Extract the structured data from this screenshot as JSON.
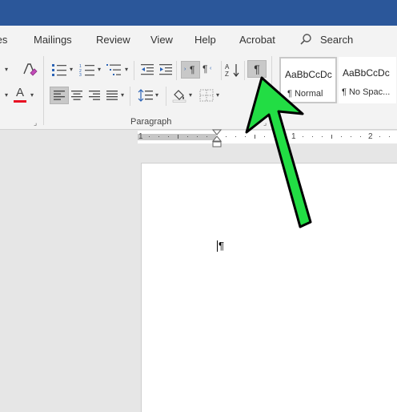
{
  "tabs": [
    "tes",
    "Mailings",
    "Review",
    "View",
    "Help",
    "Acrobat"
  ],
  "search": {
    "label": "Search"
  },
  "ribbon": {
    "group_label": "Paragraph",
    "show_hide_symbol": "¶",
    "ltr_symbol": "¶",
    "rtl_symbol": "¶",
    "font_color_letter": "A",
    "font_color": "#e81123"
  },
  "styles": [
    {
      "preview": "AaBbCcDc",
      "name": "¶ Normal"
    },
    {
      "preview": "AaBbCcDc",
      "name": "¶ No Spac..."
    }
  ],
  "ruler": {
    "numbers": [
      "1",
      "1",
      "2"
    ]
  },
  "document": {
    "paragraph_mark": "¶"
  },
  "annotation": {
    "color": "#22dd44",
    "target": "show-hide-button"
  }
}
